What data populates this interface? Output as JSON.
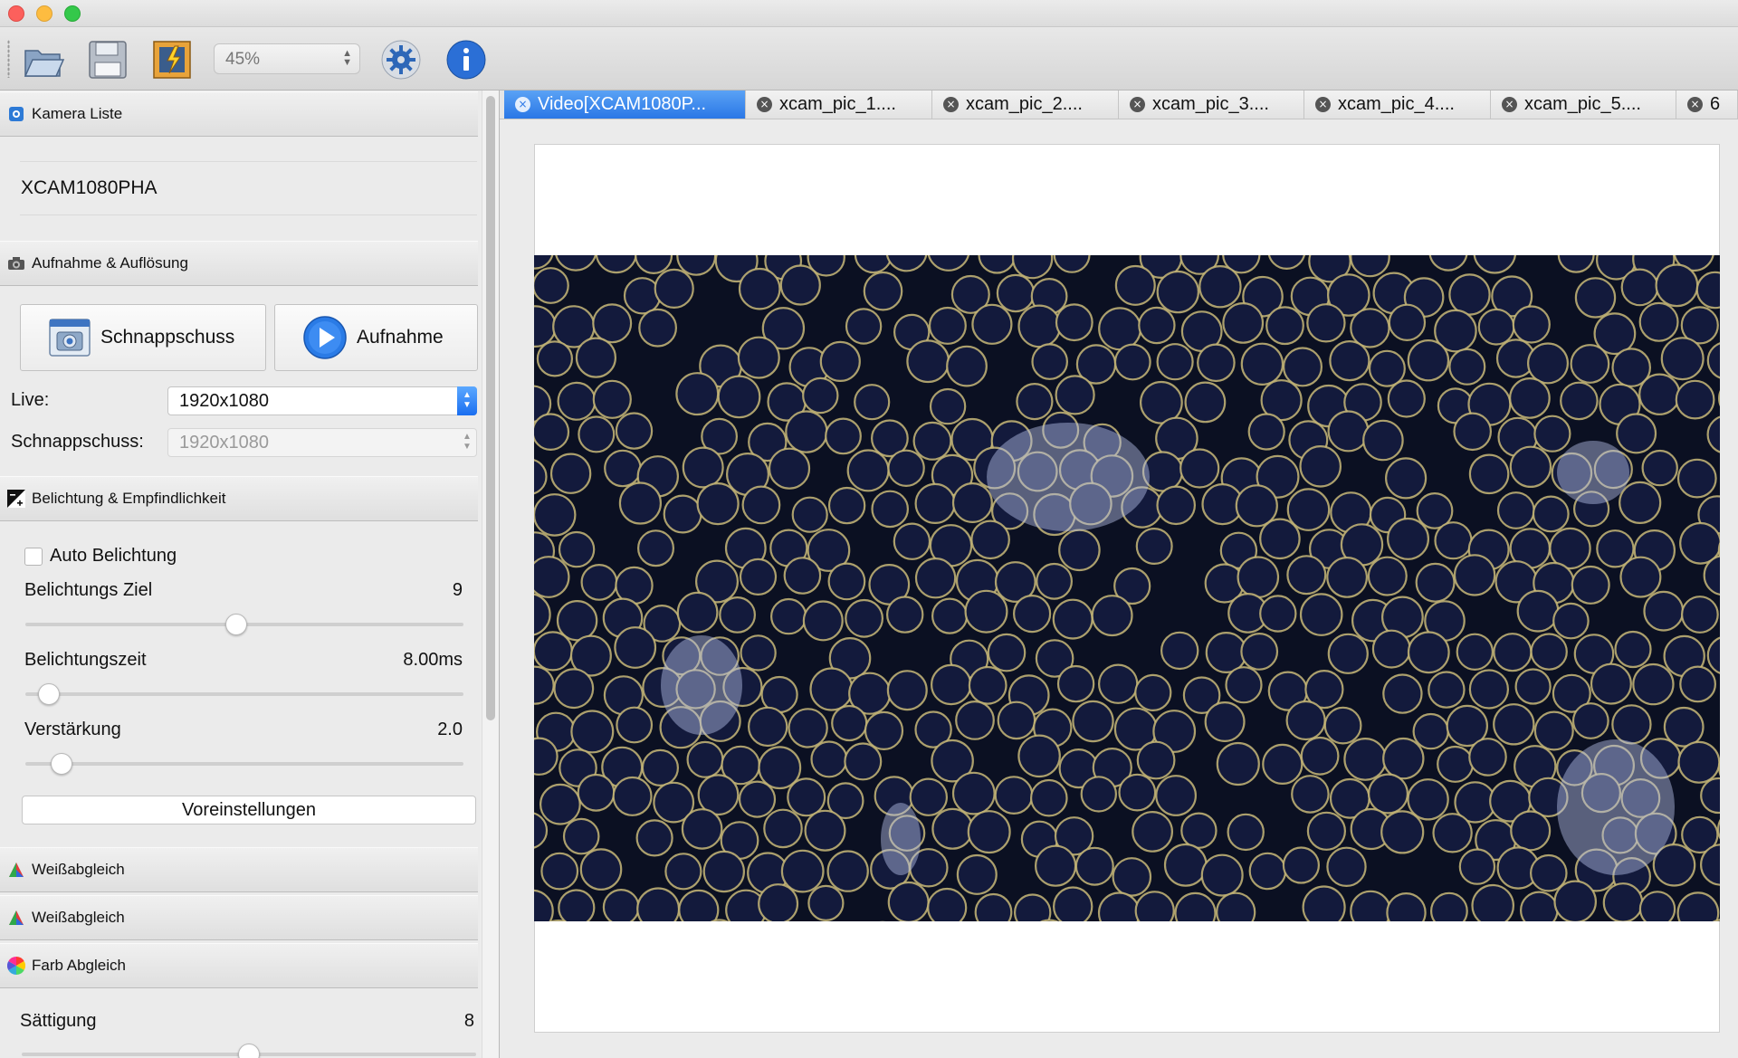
{
  "toolbar": {
    "icons": [
      "open-folder-icon",
      "save-disk-icon",
      "export-image-icon",
      "settings-gear-icon",
      "info-icon"
    ],
    "zoom_value": "45%"
  },
  "sidebar": {
    "camera_list": {
      "title": "Kamera Liste",
      "cameras": [
        "XCAM1080PHA"
      ]
    },
    "capture": {
      "title": "Aufnahme & Auflösung",
      "snapshot_button": "Schnappschuss",
      "record_button": "Aufnahme",
      "live_label": "Live:",
      "live_value": "1920x1080",
      "snapshot_label": "Schnappschuss:",
      "snapshot_value": "1920x1080"
    },
    "exposure": {
      "title": "Belichtung & Empfindlichkeit",
      "auto_label": "Auto Belichtung",
      "auto_checked": false,
      "target_label": "Belichtungs Ziel",
      "target_value": "9",
      "target_level": 0.48,
      "time_label": "Belichtungszeit",
      "time_value": "8.00ms",
      "time_level": 0.03,
      "gain_label": "Verstärkung",
      "gain_value": "2.0",
      "gain_level": 0.06,
      "defaults_button": "Voreinstellungen"
    },
    "white_balance_1": {
      "title": "Weißabgleich"
    },
    "white_balance_2": {
      "title": "Weißabgleich"
    },
    "color": {
      "title": "Farb Abgleich",
      "saturation_label": "Sättigung",
      "saturation_value": "8",
      "saturation_level": 0.5
    }
  },
  "tabs": [
    {
      "label": "Video[XCAM1080P...",
      "active": true
    },
    {
      "label": "xcam_pic_1....",
      "active": false
    },
    {
      "label": "xcam_pic_2....",
      "active": false
    },
    {
      "label": "xcam_pic_3....",
      "active": false
    },
    {
      "label": "xcam_pic_4....",
      "active": false
    },
    {
      "label": "xcam_pic_5....",
      "active": false
    },
    {
      "label": "6",
      "active": false
    }
  ],
  "colors": {
    "accent": "#2a77e6",
    "image_background": "#0b1022",
    "cell_ring": "#c8b878"
  }
}
